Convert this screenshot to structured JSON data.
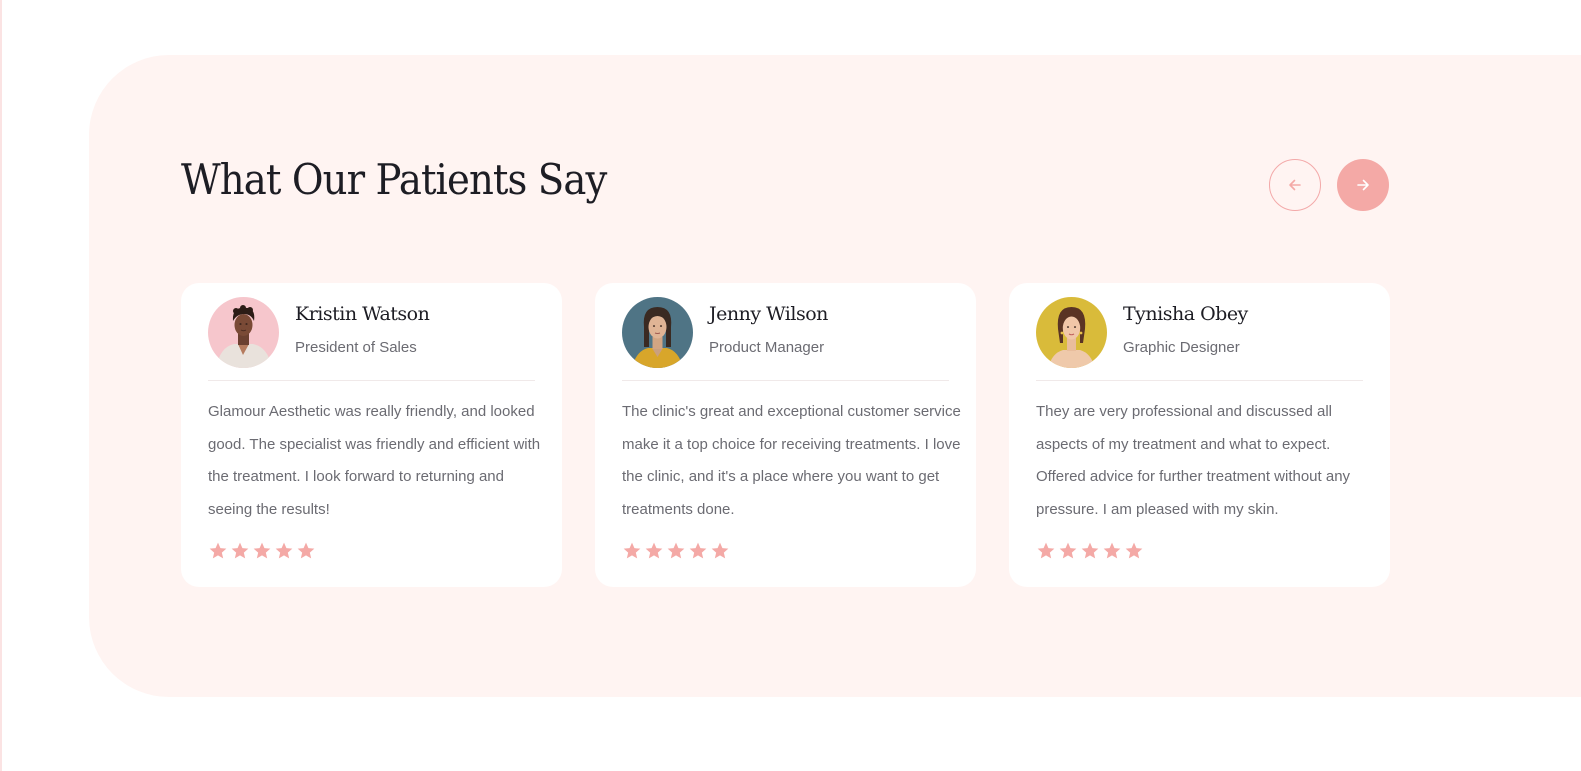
{
  "section": {
    "title": "What Our Patients Say"
  },
  "nav": {
    "prev_icon": "arrow-left-icon",
    "next_icon": "arrow-right-icon"
  },
  "colors": {
    "accent": "#f4a9a6",
    "section_bg": "#fff4f2",
    "heading": "#1d1d24",
    "body_text": "#6b6b72"
  },
  "testimonials": [
    {
      "name": "Kristin Watson",
      "role": "President of Sales",
      "quote": "Glamour Aesthetic was really friendly, and looked good. The specialist was friendly and efficient with the treatment. I look forward to returning and seeing the results!",
      "rating": 5,
      "rating_max": 5
    },
    {
      "name": "Jenny Wilson",
      "role": "Product Manager",
      "quote": "The clinic's great and exceptional customer service make it a top choice for receiving treatments. I love the clinic, and it's a place where you want to get treatments done.",
      "rating": 5,
      "rating_max": 5
    },
    {
      "name": "Tynisha Obey",
      "role": "Graphic Designer",
      "quote": "They are very professional and discussed all aspects of my treatment and what to expect. Offered advice for further treatment without any pressure. I am pleased with my skin.",
      "rating": 5,
      "rating_max": 5
    }
  ]
}
